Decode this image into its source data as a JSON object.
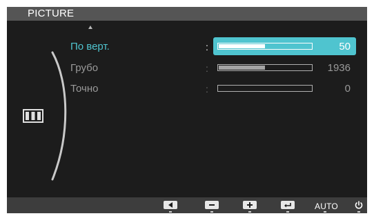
{
  "osd": {
    "title": "PICTURE",
    "menu_items": [
      {
        "label": "По верт.",
        "value": "50",
        "level": 0.5,
        "selected": true
      },
      {
        "label": "Грубо",
        "value": "1936",
        "level": 0.5,
        "selected": false
      },
      {
        "label": "Точно",
        "value": "0",
        "level": 0.0,
        "selected": false
      }
    ],
    "colon": ":",
    "bottom_bar": {
      "buttons": [
        {
          "name": "left-arrow-icon"
        },
        {
          "name": "minus-icon"
        },
        {
          "name": "plus-icon"
        },
        {
          "name": "enter-icon"
        },
        {
          "name": "auto-button",
          "label": "AUTO"
        },
        {
          "name": "power-icon"
        }
      ]
    },
    "colors": {
      "highlight": "#4fc4cf",
      "background": "#1c1c1c",
      "title_bar": "#555555",
      "bottom_bar": "#3d3d3d"
    }
  }
}
